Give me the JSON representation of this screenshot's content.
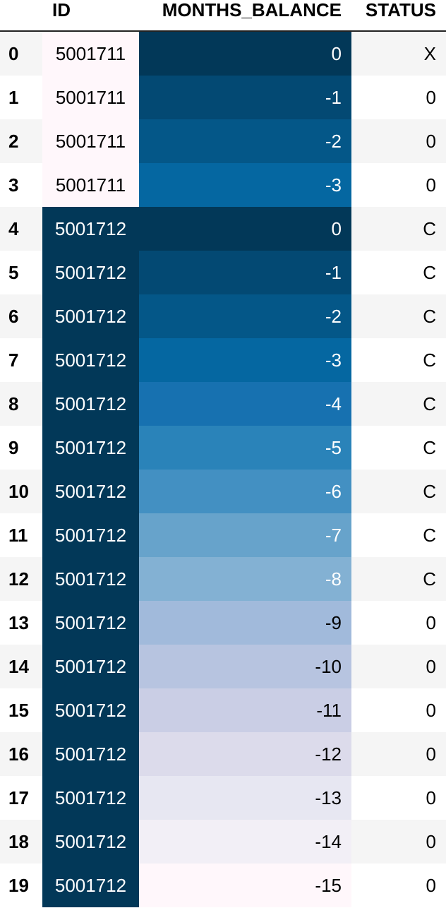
{
  "table": {
    "headers": {
      "index": "",
      "id": "ID",
      "months_balance": "MONTHS_BALANCE",
      "status": "STATUS"
    },
    "rows": [
      {
        "index": "0",
        "id": "5001711",
        "months_balance": "0",
        "status": "X",
        "id_bg": "#fff7fb",
        "id_fg": "#000000",
        "mb_bg": "#023858",
        "mb_fg": "#ffffff"
      },
      {
        "index": "1",
        "id": "5001711",
        "months_balance": "-1",
        "status": "0",
        "id_bg": "#fff7fb",
        "id_fg": "#000000",
        "mb_bg": "#034973",
        "mb_fg": "#ffffff"
      },
      {
        "index": "2",
        "id": "5001711",
        "months_balance": "-2",
        "status": "0",
        "id_bg": "#fff7fb",
        "id_fg": "#000000",
        "mb_bg": "#045788",
        "mb_fg": "#ffffff"
      },
      {
        "index": "3",
        "id": "5001711",
        "months_balance": "-3",
        "status": "0",
        "id_bg": "#fff7fb",
        "id_fg": "#000000",
        "mb_bg": "#0567a1",
        "mb_fg": "#ffffff"
      },
      {
        "index": "4",
        "id": "5001712",
        "months_balance": "0",
        "status": "C",
        "id_bg": "#023858",
        "id_fg": "#ffffff",
        "mb_bg": "#023858",
        "mb_fg": "#ffffff"
      },
      {
        "index": "5",
        "id": "5001712",
        "months_balance": "-1",
        "status": "C",
        "id_bg": "#023858",
        "id_fg": "#ffffff",
        "mb_bg": "#034973",
        "mb_fg": "#ffffff"
      },
      {
        "index": "6",
        "id": "5001712",
        "months_balance": "-2",
        "status": "C",
        "id_bg": "#023858",
        "id_fg": "#ffffff",
        "mb_bg": "#045788",
        "mb_fg": "#ffffff"
      },
      {
        "index": "7",
        "id": "5001712",
        "months_balance": "-3",
        "status": "C",
        "id_bg": "#023858",
        "id_fg": "#ffffff",
        "mb_bg": "#0567a1",
        "mb_fg": "#ffffff"
      },
      {
        "index": "8",
        "id": "5001712",
        "months_balance": "-4",
        "status": "C",
        "id_bg": "#023858",
        "id_fg": "#ffffff",
        "mb_bg": "#1771b0",
        "mb_fg": "#ffffff"
      },
      {
        "index": "9",
        "id": "5001712",
        "months_balance": "-5",
        "status": "C",
        "id_bg": "#023858",
        "id_fg": "#ffffff",
        "mb_bg": "#2a83b9",
        "mb_fg": "#ffffff"
      },
      {
        "index": "10",
        "id": "5001712",
        "months_balance": "-6",
        "status": "C",
        "id_bg": "#023858",
        "id_fg": "#ffffff",
        "mb_bg": "#4390c2",
        "mb_fg": "#ffffff"
      },
      {
        "index": "11",
        "id": "5001712",
        "months_balance": "-7",
        "status": "C",
        "id_bg": "#023858",
        "id_fg": "#ffffff",
        "mb_bg": "#67a3cb",
        "mb_fg": "#ffffff"
      },
      {
        "index": "12",
        "id": "5001712",
        "months_balance": "-8",
        "status": "C",
        "id_bg": "#023858",
        "id_fg": "#ffffff",
        "mb_bg": "#83b1d3",
        "mb_fg": "#ffffff"
      },
      {
        "index": "13",
        "id": "5001712",
        "months_balance": "-9",
        "status": "0",
        "id_bg": "#023858",
        "id_fg": "#ffffff",
        "mb_bg": "#a1badb",
        "mb_fg": "#000000"
      },
      {
        "index": "14",
        "id": "5001712",
        "months_balance": "-10",
        "status": "0",
        "id_bg": "#023858",
        "id_fg": "#ffffff",
        "mb_bg": "#b7c4e0",
        "mb_fg": "#000000"
      },
      {
        "index": "15",
        "id": "5001712",
        "months_balance": "-11",
        "status": "0",
        "id_bg": "#023858",
        "id_fg": "#ffffff",
        "mb_bg": "#cacee5",
        "mb_fg": "#000000"
      },
      {
        "index": "16",
        "id": "5001712",
        "months_balance": "-12",
        "status": "0",
        "id_bg": "#023858",
        "id_fg": "#ffffff",
        "mb_bg": "#dcdbeb",
        "mb_fg": "#000000"
      },
      {
        "index": "17",
        "id": "5001712",
        "months_balance": "-13",
        "status": "0",
        "id_bg": "#023858",
        "id_fg": "#ffffff",
        "mb_bg": "#e7e7f2",
        "mb_fg": "#000000"
      },
      {
        "index": "18",
        "id": "5001712",
        "months_balance": "-14",
        "status": "0",
        "id_bg": "#023858",
        "id_fg": "#ffffff",
        "mb_bg": "#f2eff6",
        "mb_fg": "#000000"
      },
      {
        "index": "19",
        "id": "5001712",
        "months_balance": "-15",
        "status": "0",
        "id_bg": "#023858",
        "id_fg": "#ffffff",
        "mb_bg": "#fff7fb",
        "mb_fg": "#000000"
      }
    ]
  }
}
